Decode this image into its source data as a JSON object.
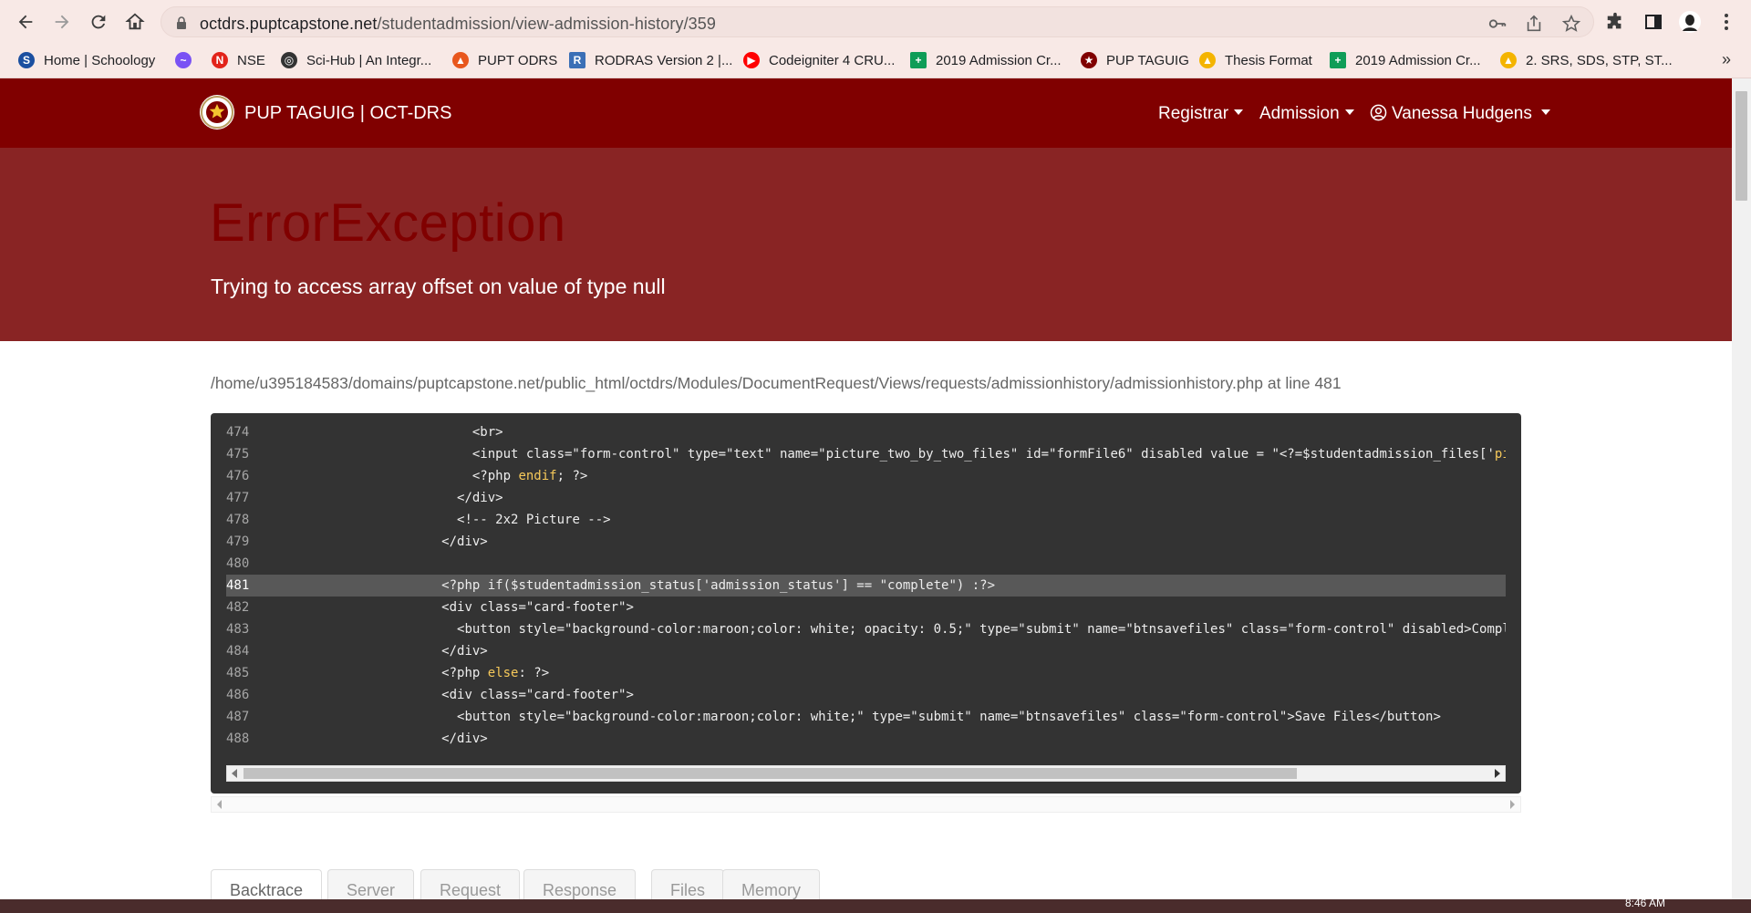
{
  "browser": {
    "url_host": "octdrs.puptcapstone.net",
    "url_path": "/studentadmission/view-admission-history/359",
    "bookmarks": [
      {
        "label": "Home | Schoology",
        "icon": "schoology-icon",
        "color": "#1b4fa0"
      },
      {
        "label": "",
        "icon": "messenger-icon",
        "color": "#7a52f4"
      },
      {
        "label": "NSE",
        "icon": "nse-icon",
        "color": "#e2231a"
      },
      {
        "label": "Sci-Hub | An Integr...",
        "icon": "scihub-icon",
        "color": "#333333"
      },
      {
        "label": "PUPT ODRS",
        "icon": "flame-icon",
        "color": "#e8571d"
      },
      {
        "label": "RODRAS Version 2 |...",
        "icon": "rodras-icon",
        "color": "#3b6fb6"
      },
      {
        "label": "Codeigniter 4 CRU...",
        "icon": "youtube-icon",
        "color": "#ff0000"
      },
      {
        "label": "2019 Admission Cr...",
        "icon": "sheets-icon",
        "color": "#0f9d58"
      },
      {
        "label": "PUP TAGUIG",
        "icon": "pup-seal-icon",
        "color": "#800000"
      },
      {
        "label": "Thesis Format",
        "icon": "drive-icon",
        "color": "#f4b400"
      },
      {
        "label": "2019 Admission Cr...",
        "icon": "sheets-icon",
        "color": "#0f9d58"
      },
      {
        "label": "2. SRS, SDS, STP, ST...",
        "icon": "drive-icon",
        "color": "#f4b400"
      }
    ],
    "more_bookmarks": "»"
  },
  "navbar": {
    "brand": "PUP TAGUIG | OCT-DRS",
    "links": [
      "Registrar",
      "Admission"
    ],
    "user": "Vanessa Hudgens"
  },
  "error": {
    "title": "ErrorException",
    "message": "Trying to access array offset on value of type null",
    "path": "/home/u395184583/domains/puptcapstone.net/public_html/octdrs/Modules/DocumentRequest/Views/requests/admissionhistory/admissionhistory.php at line 481"
  },
  "code": {
    "highlight_line": "481",
    "lines": [
      {
        "n": "474",
        "indent": "                ",
        "segments": [
          {
            "t": "<br>"
          }
        ]
      },
      {
        "n": "475",
        "indent": "                ",
        "segments": [
          {
            "t": "<input class=\"form-control\" type=\"text\" name=\"picture_two_by_two_files\" id=\"formFile6\" disabled value = \"<?=$studentadmission_files['"
          },
          {
            "t": "pi",
            "k": "kw"
          }
        ]
      },
      {
        "n": "476",
        "indent": "                ",
        "segments": [
          {
            "t": "<?php "
          },
          {
            "t": "endif",
            "k": "kw"
          },
          {
            "t": "; ?>"
          }
        ]
      },
      {
        "n": "477",
        "indent": "              ",
        "segments": [
          {
            "t": "</div>"
          }
        ]
      },
      {
        "n": "478",
        "indent": "              ",
        "segments": [
          {
            "t": "<!-- 2x2 Picture -->"
          }
        ]
      },
      {
        "n": "479",
        "indent": "            ",
        "segments": [
          {
            "t": "</div>"
          }
        ]
      },
      {
        "n": "480",
        "indent": "",
        "segments": [
          {
            "t": ""
          }
        ]
      },
      {
        "n": "481",
        "indent": "            ",
        "segments": [
          {
            "t": "<?php if($studentadmission_status['admission_status'] == \"complete\") :?>"
          }
        ]
      },
      {
        "n": "482",
        "indent": "            ",
        "segments": [
          {
            "t": "<div class=\"card-footer\">"
          }
        ]
      },
      {
        "n": "483",
        "indent": "              ",
        "segments": [
          {
            "t": "<button style=\"background-color:maroon;color: white; opacity: 0.5;\" type=\"submit\" name=\"btnsavefiles\" class=\"form-control\" disabled>Compl"
          }
        ]
      },
      {
        "n": "484",
        "indent": "            ",
        "segments": [
          {
            "t": "</div>"
          }
        ]
      },
      {
        "n": "485",
        "indent": "            ",
        "segments": [
          {
            "t": "<?php "
          },
          {
            "t": "else",
            "k": "kw"
          },
          {
            "t": ": ?>"
          }
        ]
      },
      {
        "n": "486",
        "indent": "            ",
        "segments": [
          {
            "t": "<div class=\"card-footer\">"
          }
        ]
      },
      {
        "n": "487",
        "indent": "              ",
        "segments": [
          {
            "t": "<button style=\"background-color:maroon;color: white;\" type=\"submit\" name=\"btnsavefiles\" class=\"form-control\">Save Files</button>"
          }
        ]
      },
      {
        "n": "488",
        "indent": "            ",
        "segments": [
          {
            "t": "</div>"
          }
        ]
      }
    ]
  },
  "tabs": [
    "Backtrace",
    "Server",
    "Request",
    "Response",
    "Files",
    "Memory"
  ],
  "active_tab": "Backtrace",
  "clock": "8:46 AM"
}
